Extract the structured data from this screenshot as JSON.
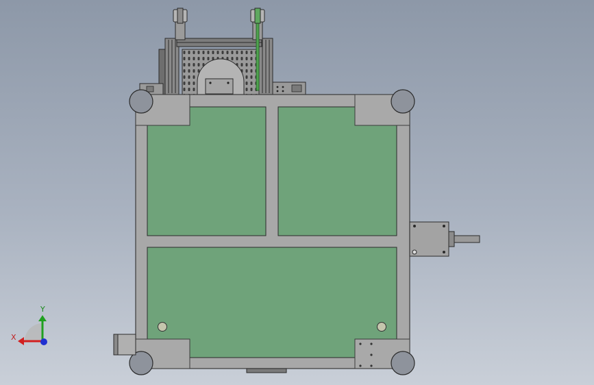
{
  "view": {
    "background": {
      "top": "#8d98a8",
      "bottom": "#c9cfd8"
    }
  },
  "axes_triad": {
    "x_label": "X",
    "y_label": "Y",
    "x_color": "#d22020",
    "y_color": "#20a020",
    "z_color": "#2030d0"
  },
  "colors": {
    "frame": "#a8a8a8",
    "frame_edge": "#3a3a3a",
    "panel": "#6fa37a",
    "caster": "#8e939c",
    "motor": "#a3a3a3"
  }
}
